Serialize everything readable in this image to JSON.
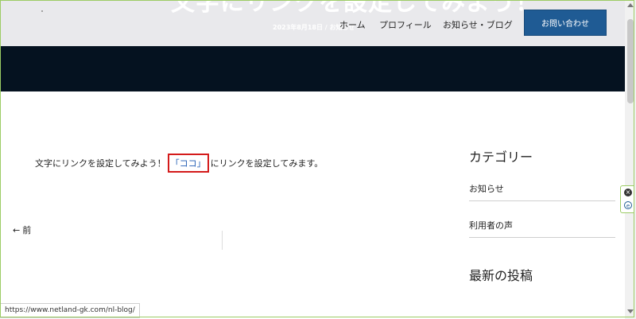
{
  "header": {
    "hero_title": "文字にリンクを設定してみよう！",
    "hero_date": "2023年8月18日 / お知らせ",
    "nav": {
      "home": "ホーム",
      "profile": "プロフィール",
      "news_blog": "お知らせ・ブログ"
    },
    "cta_label": "お問い合わせ"
  },
  "post": {
    "text_before": "文字にリンクを設定してみよう！",
    "link_text": "「ココ」",
    "text_after": "にリンクを設定してみます。",
    "prev_arrow": "←",
    "prev_label": "前"
  },
  "sidebar": {
    "categories_title": "カテゴリー",
    "categories": [
      {
        "label": "お知らせ"
      },
      {
        "label": "利用者の声"
      }
    ],
    "recent_title": "最新の投稿"
  },
  "status_bar": {
    "url": "https://www.netland-gk.com/nl-blog/"
  },
  "widget": {
    "close_glyph": "×",
    "logo_glyph": "e"
  },
  "colors": {
    "cta_bg": "#1f5b94",
    "dark_band": "#051220",
    "link": "#1f5bb3",
    "highlight_box": "#d41b1b",
    "frame": "#9ccc65"
  }
}
